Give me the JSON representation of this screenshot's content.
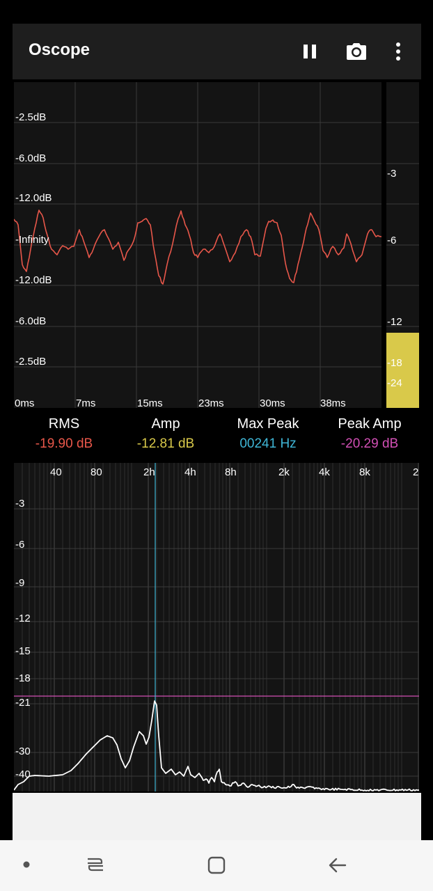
{
  "app": {
    "title": "Oscope",
    "icons": [
      "pause-icon",
      "camera-icon",
      "more-vert-icon"
    ]
  },
  "scope": {
    "y_labels": [
      "-2.5dB",
      "-6.0dB",
      "-12.0dB",
      "-Infinity",
      "-12.0dB",
      "-6.0dB",
      "-2.5dB"
    ],
    "x_labels": [
      "0ms",
      "7ms",
      "15ms",
      "23ms",
      "30ms",
      "38ms"
    ],
    "trace_color": "#e8574a"
  },
  "meter": {
    "labels": [
      "-3",
      "-6",
      "-12",
      "-18",
      "-24"
    ],
    "fill_color": "#d9c94a",
    "level_fraction": 0.23
  },
  "stats": [
    {
      "label": "RMS",
      "value": "-19.90 dB",
      "color": "#e8574a"
    },
    {
      "label": "Amp",
      "value": "-12.81 dB",
      "color": "#d9c94a"
    },
    {
      "label": "Max Peak",
      "value": "00241 Hz",
      "color": "#3fb6d6"
    },
    {
      "label": "Peak Amp",
      "value": "-20.29 dB",
      "color": "#d24fb5"
    }
  ],
  "fft": {
    "x_labels": [
      "40",
      "80",
      "2h",
      "4h",
      "8h",
      "2k",
      "4k",
      "8k",
      "2"
    ],
    "y_labels": [
      "-3",
      "-6",
      "-9",
      "-12",
      "-15",
      "-18",
      "-21",
      "-30",
      "-40"
    ],
    "peak_line_color": "#3fb6d6",
    "threshold_line_color": "#d24fb5"
  },
  "nav": {
    "icons": [
      "dot-icon",
      "recent-apps-icon",
      "home-icon",
      "back-icon"
    ]
  }
}
